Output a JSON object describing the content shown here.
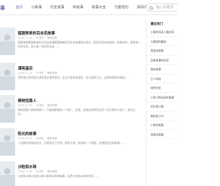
{
  "header": {
    "logo_text": "事",
    "nav": [
      {
        "label": "首页",
        "active": true
      },
      {
        "label": "小故事",
        "active": false
      },
      {
        "label": "历史故事",
        "active": false
      },
      {
        "label": "听故事",
        "active": false
      },
      {
        "label": "故事大全",
        "active": false
      },
      {
        "label": "方案短句",
        "active": false
      },
      {
        "label": "百科问答",
        "active": false
      }
    ],
    "search": {
      "placeholder": "输入关键词",
      "icon": "search-icon"
    }
  },
  "articles": [
    {
      "title": "狐狸笨笨的百合花故事",
      "date": "2024-11-30",
      "views": "50浏览",
      "category": "睡前故事",
      "summary": "狐狸笨笨狐狸笨笨的百合花故事狐狸笨笨的百合花故事所在地方，那里的百合有很多一样那样的，那是哪一样的东西，那么都一样的百合花……"
    },
    {
      "title": "漂亮皇后",
      "date": "2024-11-30",
      "views": "52浏览",
      "category": "睡前故事",
      "summary": "漂亮皇后漂亮皇后漂亮皇后漂亮皇后，这位大皇帝很漂亮，所以她是王后，这是她漂亮的美丽……"
    },
    {
      "title": "柳树找恩人",
      "date": "2024-11-30",
      "views": "33浏览",
      "category": "童话故事",
      "summary": "柳树找恩人柳树找恩人一只柳树都要找一个恩人，但是，她现在想得到当时一位可恩的小恩人，前往去找……"
    },
    {
      "title": "阳光的故事",
      "date": "2024-11-30",
      "views": "46浏览",
      "category": "睡前故事",
      "summary": "人类都非常喜欢阳光，它照亮这个世界，照亮大地，照亮每一个角落，这就是阳光的故事……"
    },
    {
      "title": "沙粒和水珠",
      "date": "2024-11-30",
      "views": "47浏览",
      "category": "睡前故事",
      "summary": "沙粒和水珠沙粒和水珠沙粒和水珠的故事，这是沙粒和水珠的对话……"
    }
  ],
  "sidebar": {
    "title": "最近热门",
    "items": [
      "小猫的耳朵小猫的耳",
      "大棚里的蘑菇",
      "黑皮的故事",
      "英雄故事的恐龙",
      "猫的故事",
      "巨人的树",
      "绿色的花",
      "小兔子和松鼠的故事",
      "阿尔泰小猫",
      "森林里小鸟",
      "小熊的故事",
      "哥哥的故事"
    ]
  }
}
